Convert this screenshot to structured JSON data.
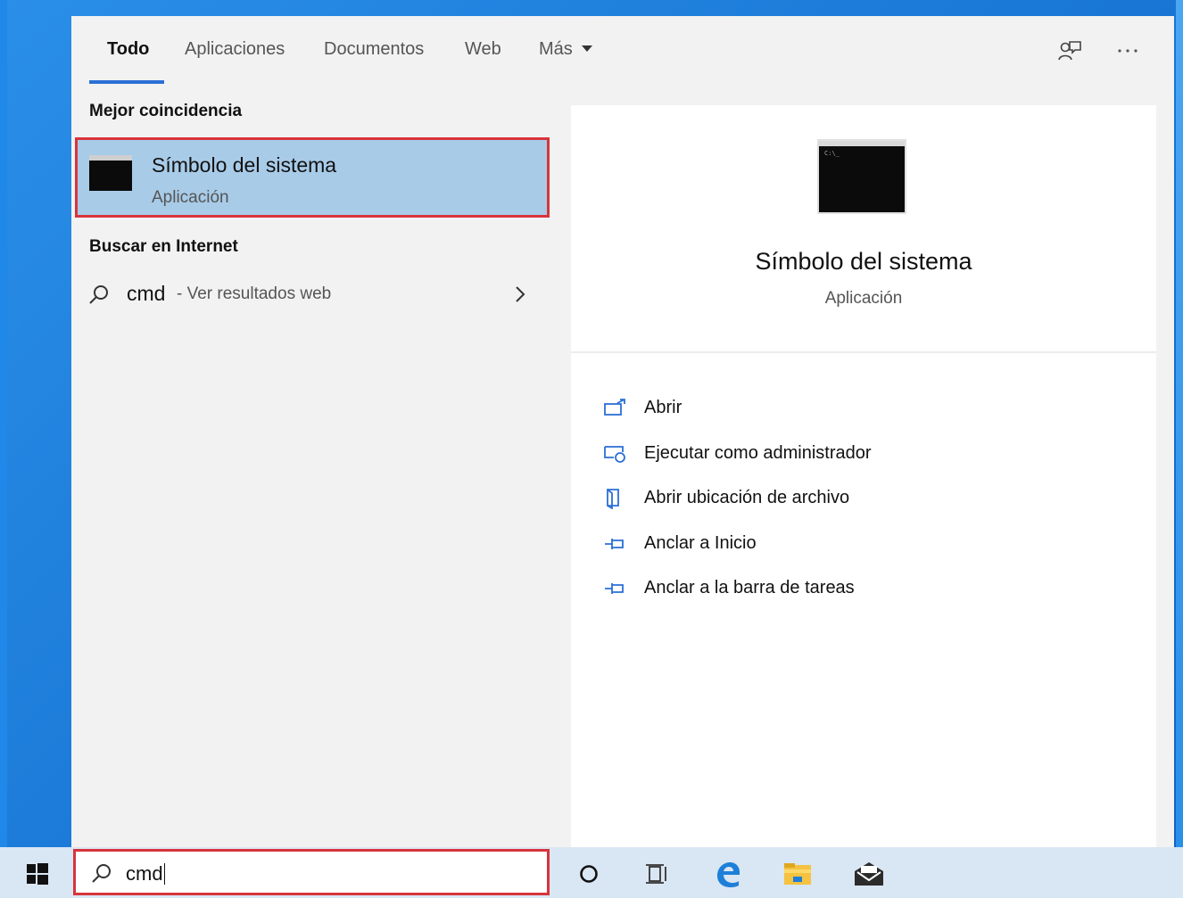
{
  "tabs": [
    {
      "label": "Todo",
      "active": true
    },
    {
      "label": "Aplicaciones"
    },
    {
      "label": "Documentos"
    },
    {
      "label": "Web"
    },
    {
      "label": "Más"
    }
  ],
  "toolbar_icons": [
    "feedback-icon",
    "more-icon"
  ],
  "left": {
    "best_match_title": "Mejor coincidencia",
    "best_match": {
      "title": "Símbolo del sistema",
      "subtitle": "Aplicación"
    },
    "web_title": "Buscar en Internet",
    "web_result": {
      "query": "cmd",
      "hint": "- Ver resultados web"
    }
  },
  "detail": {
    "title": "Símbolo del sistema",
    "subtitle": "Aplicación",
    "actions": [
      {
        "label": "Abrir",
        "icon": "open-icon"
      },
      {
        "label": "Ejecutar como administrador",
        "icon": "run-as-admin-icon"
      },
      {
        "label": "Abrir ubicación de archivo",
        "icon": "file-location-icon"
      },
      {
        "label": "Anclar a Inicio",
        "icon": "pin-icon"
      },
      {
        "label": "Anclar a la barra de tareas",
        "icon": "pin-icon"
      }
    ]
  },
  "taskbar": {
    "search_value": "cmd",
    "icons": [
      "windows-start-icon",
      "cortana-icon",
      "task-view-icon",
      "edge-icon",
      "file-explorer-icon",
      "mail-icon"
    ]
  },
  "colors": {
    "accent": "#2b6fd6",
    "highlight": "#d8343c",
    "selected": "#a8cbe8"
  }
}
